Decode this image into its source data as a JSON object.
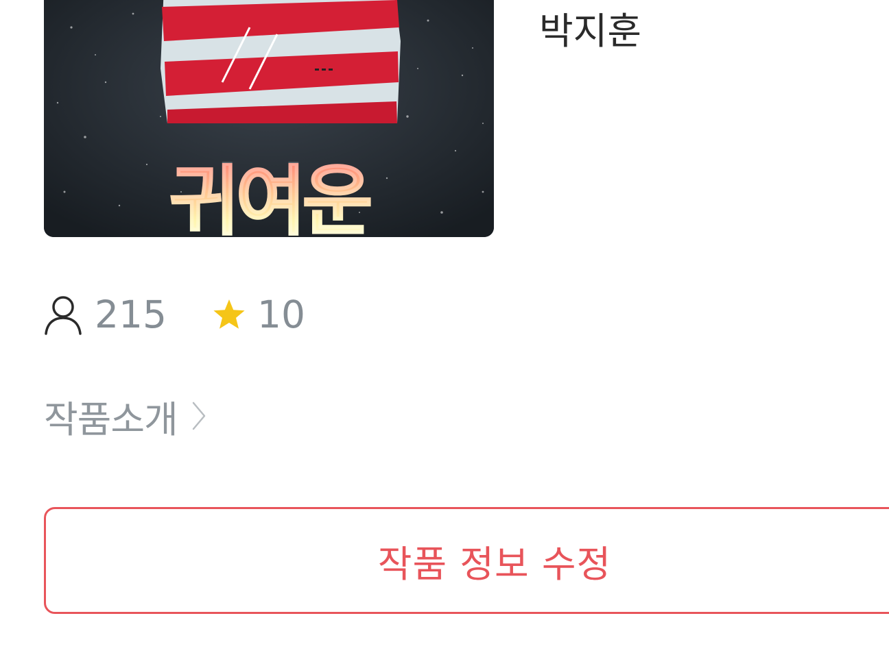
{
  "work": {
    "cover_title": "귀여운",
    "author": "박지훈"
  },
  "stats": {
    "readers_icon": "person-icon",
    "readers": "215",
    "rating_icon": "star-icon",
    "rating": "10"
  },
  "intro": {
    "label": "작품소개",
    "chevron_icon": "chevron-right-icon"
  },
  "edit_button": {
    "label": "작품 정보 수정"
  },
  "colors": {
    "accent": "#e8545a",
    "star": "#f5c518",
    "stat_text": "#858d94",
    "author_text": "#2a2a2a"
  }
}
